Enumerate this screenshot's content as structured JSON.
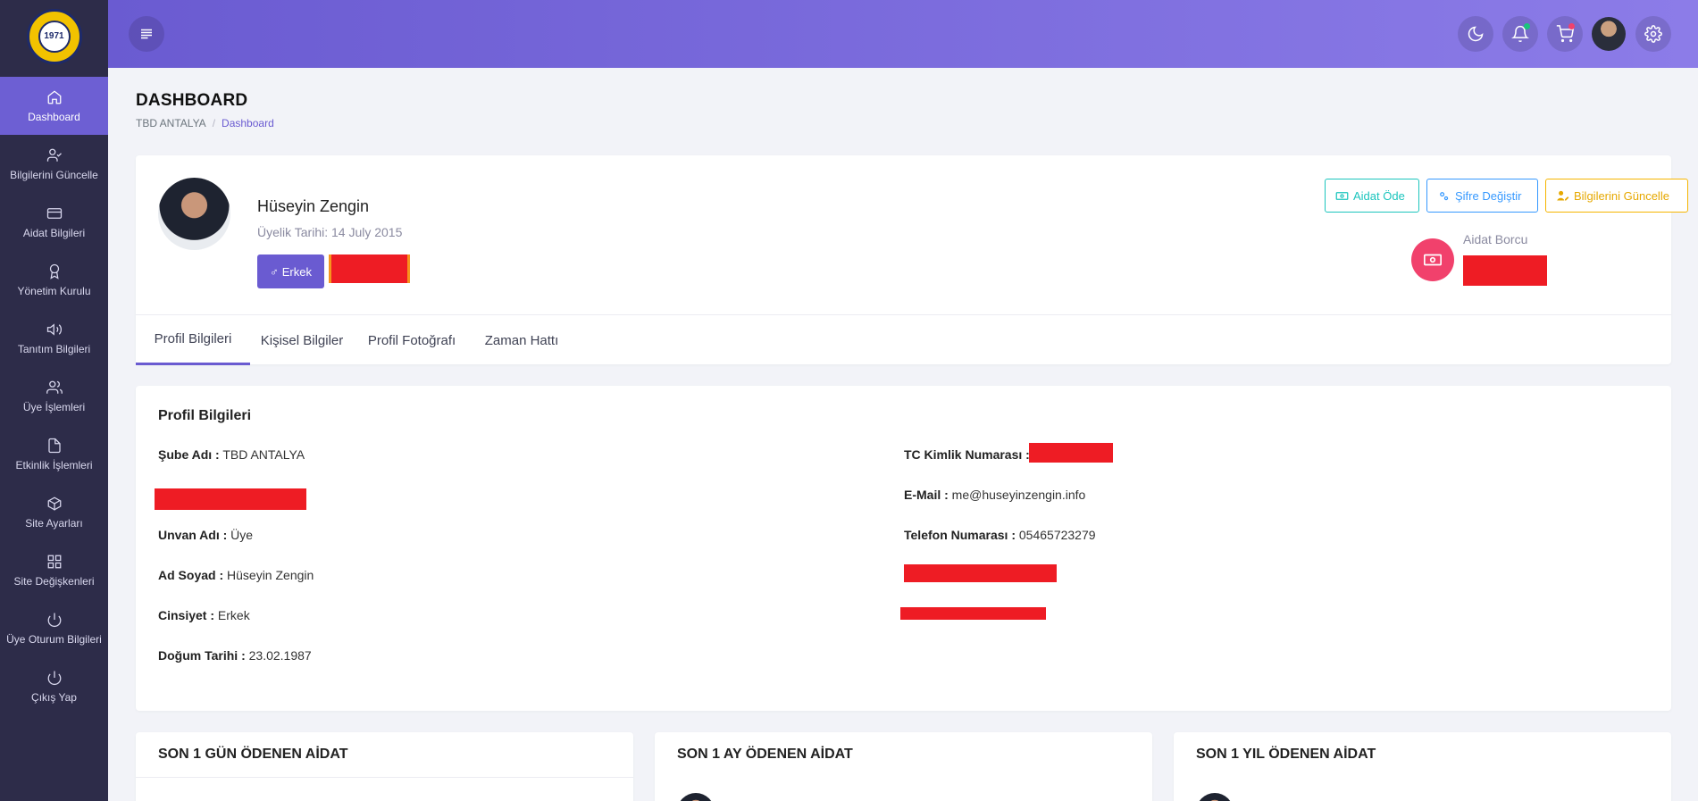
{
  "logo": {
    "year": "1971"
  },
  "sidebar": {
    "items": [
      {
        "label": "Dashboard",
        "icon": "home-icon"
      },
      {
        "label": "Bilgilerini Güncelle",
        "icon": "user-check-icon"
      },
      {
        "label": "Aidat Bilgileri",
        "icon": "credit-card-icon"
      },
      {
        "label": "Yönetim Kurulu",
        "icon": "award-icon"
      },
      {
        "label": "Tanıtım Bilgileri",
        "icon": "volume-icon"
      },
      {
        "label": "Üye İşlemleri",
        "icon": "users-icon"
      },
      {
        "label": "Etkinlik İşlemleri",
        "icon": "file-icon"
      },
      {
        "label": "Site Ayarları",
        "icon": "package-icon"
      },
      {
        "label": "Site Değişkenleri",
        "icon": "grid-icon"
      },
      {
        "label": "Üye Oturum Bilgileri",
        "icon": "power-icon"
      },
      {
        "label": "Çıkış Yap",
        "icon": "power-icon"
      }
    ]
  },
  "header": {
    "icons": [
      "menu-icon",
      "moon-icon",
      "bell-icon",
      "cart-icon",
      "user-avatar",
      "settings-icon"
    ],
    "colors": {
      "gradient_start": "#6a5bd1",
      "gradient_end": "#8c7ce8",
      "notification_dot": "#1bc47d",
      "cart_dot": "#f1416c"
    }
  },
  "page": {
    "title": "DASHBOARD",
    "breadcrumb": [
      "TBD ANTALYA",
      "Dashboard"
    ]
  },
  "profile": {
    "name": "Hüseyin Zengin",
    "membership": "Üyelik Tarihi: 14 July 2015",
    "gender_button": "Erkek",
    "actions": {
      "pay": "Aidat Öde",
      "password": "Şifre Değiştir",
      "update": "Bilgilerini Güncelle"
    },
    "debt_label": "Aidat Borcu",
    "tabs": [
      "Profil Bilgileri",
      "Kişisel Bilgiler",
      "Profil Fotoğrafı",
      "Zaman Hattı"
    ],
    "active_tab": "Profil Bilgileri"
  },
  "info": {
    "title": "Profil Bilgileri",
    "left": [
      {
        "label": "Şube Adı :",
        "value": "TBD ANTALYA"
      },
      {
        "label": "Unvan Adı :",
        "value": "Üye"
      },
      {
        "label": "Ad Soyad :",
        "value": "Hüseyin Zengin"
      },
      {
        "label": "Cinsiyet :",
        "value": "Erkek"
      },
      {
        "label": "Doğum Tarihi :",
        "value": "23.02.1987"
      }
    ],
    "right": [
      {
        "label": "TC Kimlik Numarası :",
        "value": ""
      },
      {
        "label": "E-Mail :",
        "value": "me@huseyinzengin.info"
      },
      {
        "label": "Telefon Numarası :",
        "value": "05465723279"
      }
    ]
  },
  "bottom": {
    "day": "SON 1 GÜN ÖDENEN AİDAT",
    "month": "SON 1 AY ÖDENEN AİDAT",
    "year": "SON 1 YIL ÖDENEN AİDAT"
  }
}
